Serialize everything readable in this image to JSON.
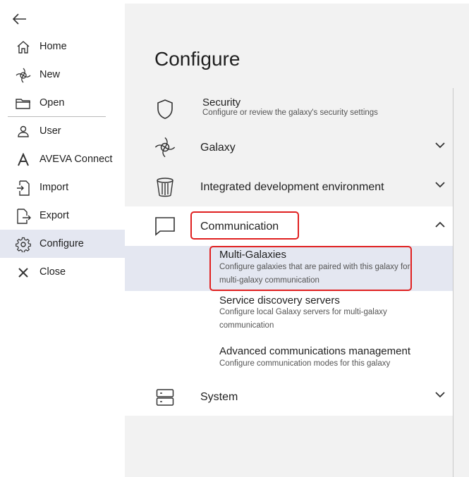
{
  "sidebar": {
    "items": [
      {
        "label": "Home",
        "icon": "home-icon"
      },
      {
        "label": "New",
        "icon": "galaxy-icon"
      },
      {
        "label": "Open",
        "icon": "folder-icon"
      },
      {
        "label": "User",
        "icon": "user-icon"
      },
      {
        "label": "AVEVA Connect",
        "icon": "aveva-icon"
      },
      {
        "label": "Import",
        "icon": "import-icon"
      },
      {
        "label": "Export",
        "icon": "export-icon"
      },
      {
        "label": "Configure",
        "icon": "gear-icon"
      },
      {
        "label": "Close",
        "icon": "close-icon"
      }
    ],
    "active": "Configure"
  },
  "main": {
    "title": "Configure",
    "sections": [
      {
        "title": "Security",
        "description": "Configure or review the galaxy's security settings",
        "icon": "shield-icon"
      },
      {
        "title": "Galaxy",
        "icon": "galaxy-icon",
        "expanded": false
      },
      {
        "title": "Integrated development environment",
        "icon": "ide-icon",
        "expanded": false
      },
      {
        "title": "Communication",
        "icon": "chat-icon",
        "expanded": true
      },
      {
        "title": "System",
        "icon": "server-icon",
        "expanded": false
      }
    ],
    "communication_items": [
      {
        "title": "Multi-Galaxies",
        "description": "Configure galaxies that are paired with this galaxy for multi-galaxy communication",
        "selected": true
      },
      {
        "title": "Service discovery servers",
        "description": "Configure local Galaxy servers for multi-galaxy communication"
      },
      {
        "title": "Advanced communications management",
        "description": "Configure communication modes for this galaxy"
      }
    ]
  },
  "colors": {
    "highlight": "#e02020",
    "selected_bg": "#e4e7f1",
    "main_bg": "#f2f2f2"
  }
}
